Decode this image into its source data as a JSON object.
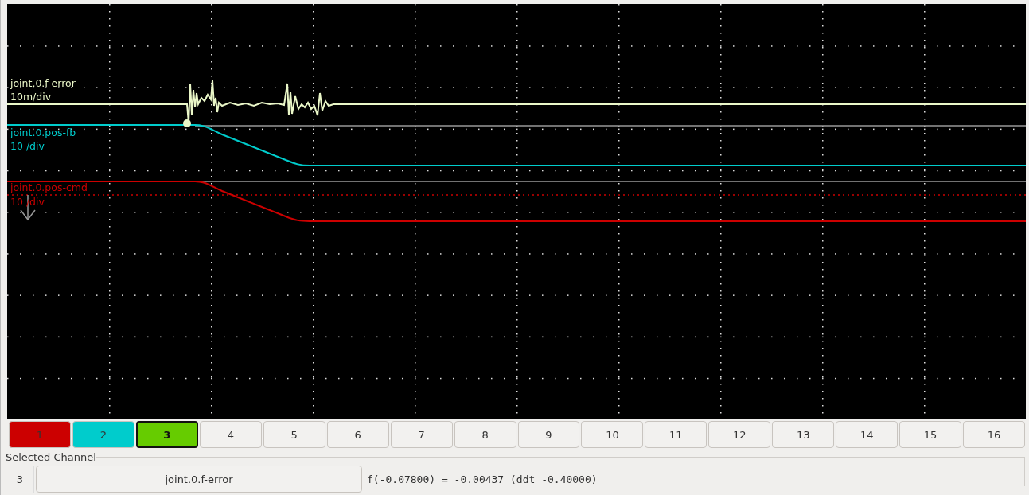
{
  "scope": {
    "channels": [
      {
        "label": "joint.0.f-error",
        "scale": "10m/div",
        "color": "#eaf7c8"
      },
      {
        "label": "joint.0.pos-fb",
        "scale": "10 /div",
        "color": "#00cccc"
      },
      {
        "label": "joint.0.pos-cmd",
        "scale": "10 /div",
        "color": "#cc0000"
      }
    ]
  },
  "channel_buttons": [
    {
      "label": "1",
      "color": "#cc0000",
      "selected": false
    },
    {
      "label": "2",
      "color": "#00cccc",
      "selected": false
    },
    {
      "label": "3",
      "color": "#66cc00",
      "selected": true
    },
    {
      "label": "4",
      "selected": false
    },
    {
      "label": "5",
      "selected": false
    },
    {
      "label": "6",
      "selected": false
    },
    {
      "label": "7",
      "selected": false
    },
    {
      "label": "8",
      "selected": false
    },
    {
      "label": "9",
      "selected": false
    },
    {
      "label": "10",
      "selected": false
    },
    {
      "label": "11",
      "selected": false
    },
    {
      "label": "12",
      "selected": false
    },
    {
      "label": "13",
      "selected": false
    },
    {
      "label": "14",
      "selected": false
    },
    {
      "label": "15",
      "selected": false
    },
    {
      "label": "16",
      "selected": false
    }
  ],
  "selected_channel": {
    "title": "Selected Channel",
    "number": "3",
    "name": "joint.0.f-error",
    "readout": "f(-0.07800) = -0.00437 (ddt -0.40000)"
  }
}
